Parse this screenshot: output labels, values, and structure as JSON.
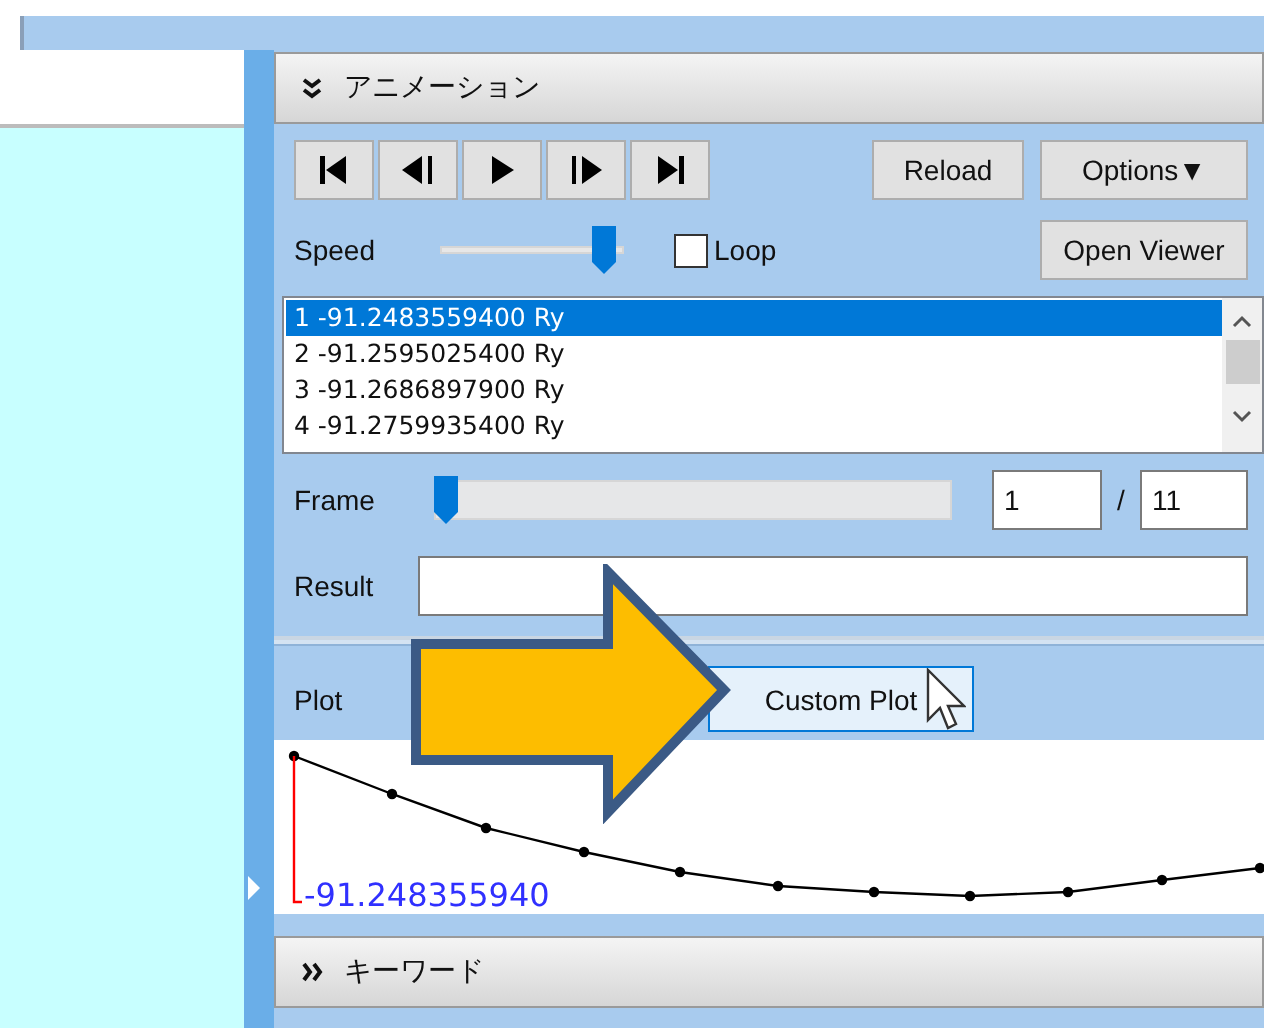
{
  "animation": {
    "title": "アニメーション",
    "expanded": true,
    "playback_buttons": [
      {
        "kind": "first"
      },
      {
        "kind": "prev"
      },
      {
        "kind": "play"
      },
      {
        "kind": "next"
      },
      {
        "kind": "last"
      }
    ],
    "reload_button": "Reload",
    "options_button": "Options▼",
    "speed": {
      "label": "Speed",
      "level": 0.95
    },
    "loop": {
      "label": "Loop",
      "checked": false
    },
    "open_viewer_button": "Open Viewer",
    "list": {
      "items": [
        {
          "text": "1 -91.2483559400 Ry",
          "selected": true
        },
        {
          "text": "2 -91.2595025400 Ry",
          "selected": false
        },
        {
          "text": "3 -91.2686897900 Ry",
          "selected": false
        },
        {
          "text": "4 -91.2759935400 Ry",
          "selected": false
        }
      ]
    },
    "frame": {
      "label": "Frame",
      "level": 0,
      "value": "1",
      "separator": "/",
      "total": "11"
    },
    "result": {
      "label": "Result"
    },
    "plot": {
      "label": "Plot",
      "button": "Custom Plot",
      "button_hovered": true,
      "value_label": "-91.248355940"
    }
  },
  "keyword": {
    "title": "キーワード",
    "expanded": false
  }
}
